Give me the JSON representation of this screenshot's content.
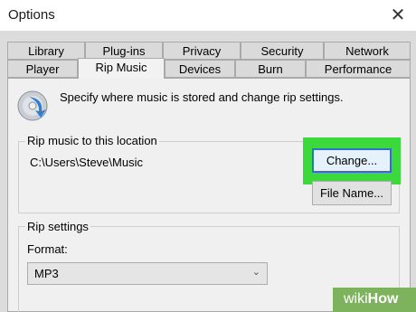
{
  "window": {
    "title": "Options"
  },
  "tabs_row1": [
    "Library",
    "Plug-ins",
    "Privacy",
    "Security",
    "Network"
  ],
  "tabs_row2": [
    "Player",
    "Rip Music",
    "Devices",
    "Burn",
    "Performance"
  ],
  "active_tab": "Rip Music",
  "intro_text": "Specify where music is stored and change rip settings.",
  "location_group": {
    "label": "Rip music to this location",
    "path": "C:\\Users\\Steve\\Music",
    "change_button": "Change...",
    "filename_button": "File Name..."
  },
  "rip_settings": {
    "label": "Rip settings",
    "format_label": "Format:",
    "format_value": "MP3"
  },
  "highlight_color": "#3bd93b",
  "watermark": {
    "prefix": "wiki",
    "suffix": "How"
  }
}
